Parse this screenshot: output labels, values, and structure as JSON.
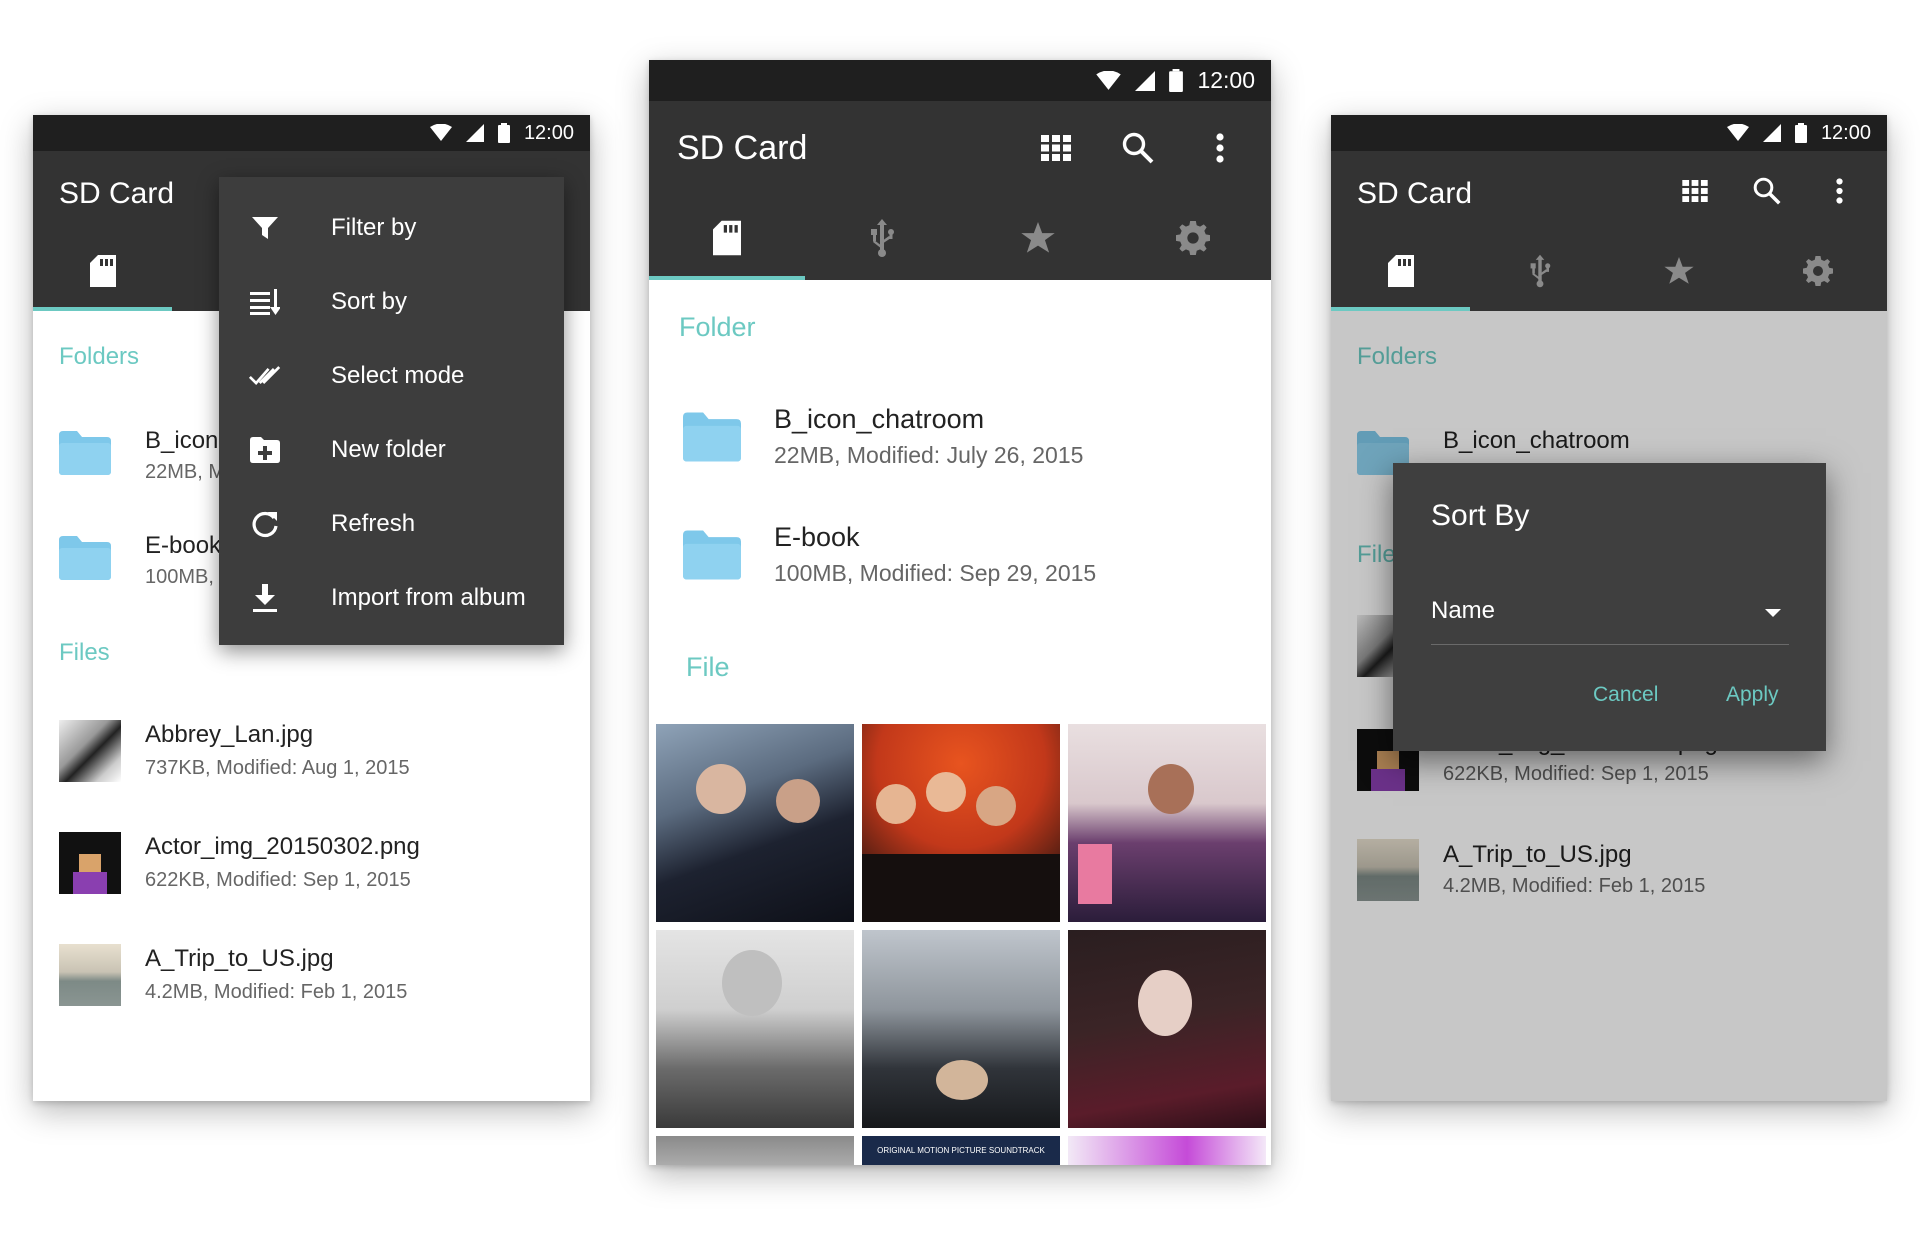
{
  "status": {
    "time": "12:00"
  },
  "left": {
    "title": "SD Card",
    "folders_header": "Folders",
    "files_header": "Files",
    "folders": [
      {
        "name": "B_icon",
        "meta": "22MB, M"
      },
      {
        "name": "E-book",
        "meta": "100MB,"
      }
    ],
    "files": [
      {
        "name": "Abbrey_Lan.jpg",
        "meta": "737KB, Modified: Aug 1, 2015"
      },
      {
        "name": "Actor_img_20150302.png",
        "meta": "622KB, Modified: Sep 1, 2015"
      },
      {
        "name": "A_Trip_to_US.jpg",
        "meta": "4.2MB, Modified: Feb 1, 2015"
      }
    ],
    "menu": [
      {
        "label": "Filter by",
        "icon": "filter-icon"
      },
      {
        "label": "Sort by",
        "icon": "sort-icon"
      },
      {
        "label": "Select mode",
        "icon": "double-check-icon"
      },
      {
        "label": "New folder",
        "icon": "new-folder-icon"
      },
      {
        "label": "Refresh",
        "icon": "refresh-icon"
      },
      {
        "label": "Import from album",
        "icon": "download-icon"
      }
    ]
  },
  "center": {
    "title": "SD Card",
    "folder_header": "Folder",
    "file_header": "File",
    "folders": [
      {
        "name": "B_icon_chatroom",
        "meta": "22MB, Modified: July 26, 2015"
      },
      {
        "name": "E-book",
        "meta": "100MB, Modified: Sep 29, 2015"
      }
    ],
    "grid_caption": "ORIGINAL MOTION PICTURE SOUNDTRACK"
  },
  "right": {
    "title": "SD Card",
    "folders_header": "Folders",
    "files_header": "File",
    "folder": {
      "name": "B_icon_chatroom"
    },
    "files": [
      {
        "name": "Actor_img_20150302.png",
        "meta": "622KB, Modified: Sep 1, 2015"
      },
      {
        "name": "A_Trip_to_US.jpg",
        "meta": "4.2MB, Modified: Feb 1, 2015"
      }
    ],
    "dialog": {
      "title": "Sort By",
      "selected": "Name",
      "cancel": "Cancel",
      "apply": "Apply"
    }
  },
  "colors": {
    "accent": "#6cc9c2",
    "toolbar": "#333333",
    "statusbar": "#1f1f1f",
    "folder": "#7ec8ea"
  }
}
